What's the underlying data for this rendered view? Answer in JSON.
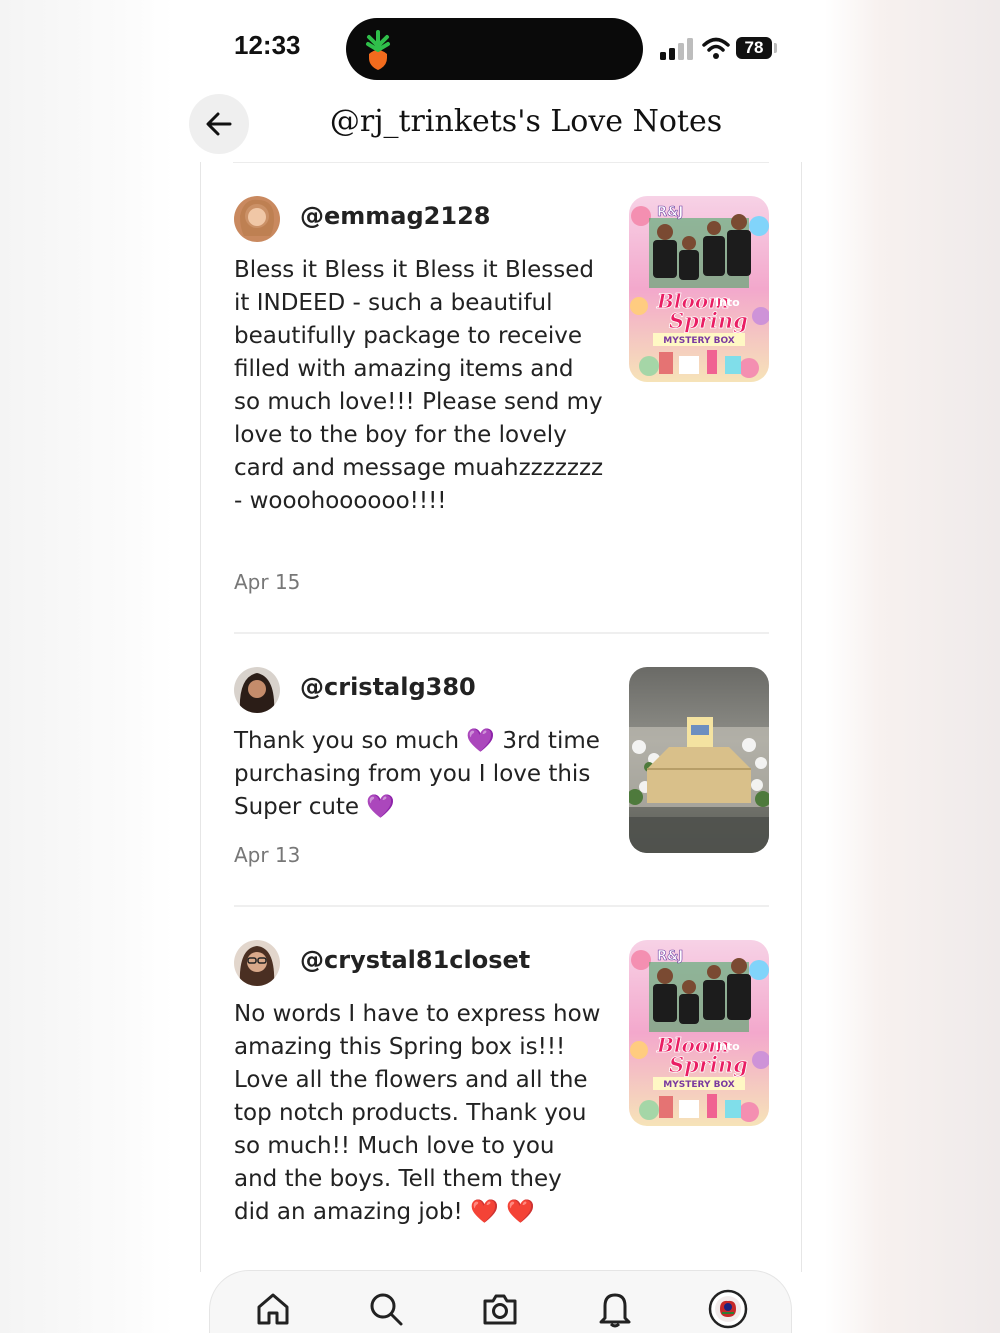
{
  "status_bar": {
    "time": "12:33",
    "battery": "78"
  },
  "header": {
    "title": "@rj_trinkets's Love Notes",
    "back_icon": "arrow-left-icon"
  },
  "notes": [
    {
      "username": "@emmag2128",
      "text": "Bless it Bless it Bless it Blessed it INDEED - such a beautiful beautifully package to receive filled with amazing items and so much love!!! Please send my love to the boy for the lovely card and message muahzzzzzzz - wooohoooooo!!!!",
      "date": "Apr 15",
      "image_banner": "R&J",
      "image_title_1": "Bloom",
      "image_title_into": "Into",
      "image_title_2": "Spring",
      "image_subtitle": "MYSTERY BOX"
    },
    {
      "username": "@cristalg380",
      "text": "Thank you so much 💜 3rd time purchasing from you I love this Super cute 💜",
      "date": "Apr 13"
    },
    {
      "username": "@crystal81closet",
      "text": "No words I have to express how amazing this Spring box is!!! Love all the flowers and all the top notch products. Thank you so much!! Much love to you and the boys. Tell them they did an amazing job! ❤️ ❤️",
      "image_banner": "R&J",
      "image_title_1": "Bloom",
      "image_title_into": "Into",
      "image_title_2": "Spring",
      "image_subtitle": "MYSTERY BOX"
    }
  ],
  "bottom_nav": {
    "items": [
      "home-icon",
      "search-icon",
      "camera-icon",
      "bell-icon",
      "profile-avatar"
    ]
  },
  "colors": {
    "accent": "#f26b1d",
    "text": "#222222",
    "muted": "#777777"
  }
}
